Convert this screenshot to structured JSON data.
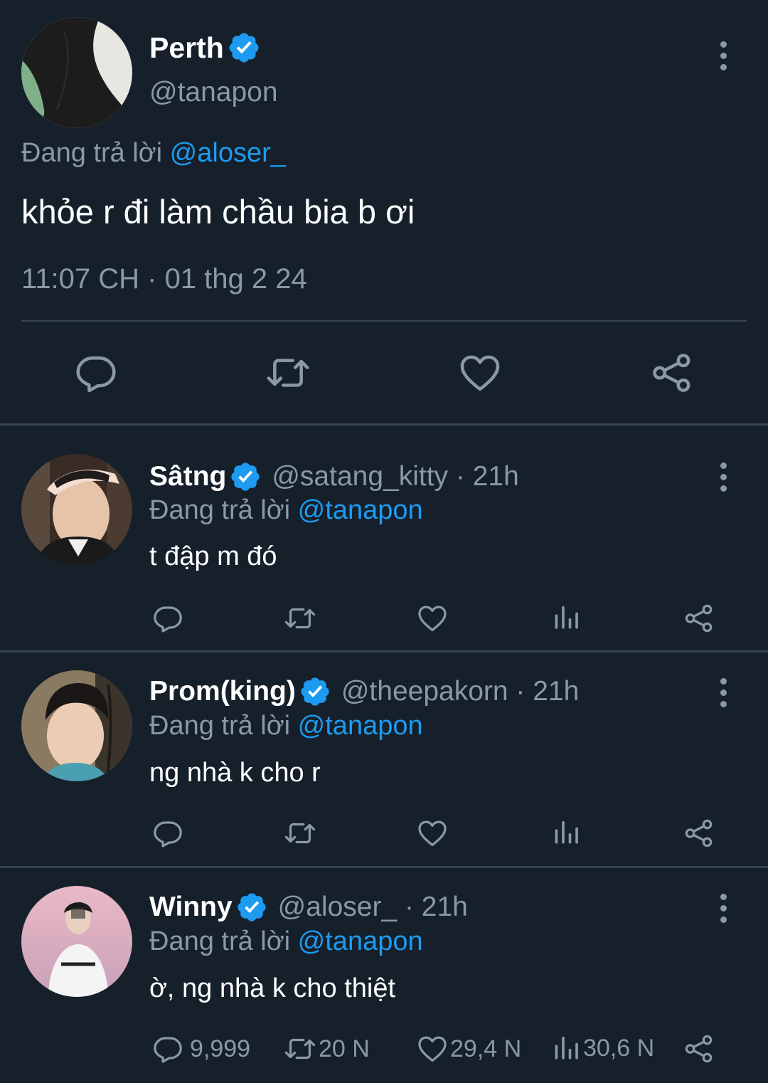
{
  "main_tweet": {
    "name": "Perth",
    "handle": "@tanapon",
    "replying_prefix": "Đang trả lời",
    "replying_to": "@aloser_",
    "text": "khỏe r đi làm chầu bia b ơi",
    "timestamp": "11:07 CH · 01 thg 2 24",
    "actions": [
      "reply-icon",
      "retweet-icon",
      "like-icon",
      "share-icon"
    ]
  },
  "replies": [
    {
      "name": "Sâtng",
      "handle": "@satang_kitty · 21h",
      "replying_prefix": "Đang trả lời",
      "replying_to": "@tanapon",
      "text": "t đập m đó",
      "counts": {
        "reply": "",
        "retweet": "",
        "like": "",
        "views": ""
      }
    },
    {
      "name": "Prom(king)",
      "handle": "@theepakorn · 21h",
      "replying_prefix": "Đang trả lời",
      "replying_to": "@tanapon",
      "text": "ng nhà k cho r",
      "counts": {
        "reply": "",
        "retweet": "",
        "like": "",
        "views": ""
      }
    },
    {
      "name": "Winny",
      "handle": "@aloser_ · 21h",
      "replying_prefix": "Đang trả lời",
      "replying_to": "@tanapon",
      "text": "ờ, ng nhà k cho thiệt",
      "counts": {
        "reply": "9,999",
        "retweet": "20 N",
        "like": "29,4 N",
        "views": "30,6 N"
      }
    }
  ],
  "colors": {
    "background": "#15202b",
    "divider": "#38444d",
    "secondary_text": "#8b98a5",
    "link": "#1d9bf0",
    "verified": "#1d9bf0"
  }
}
